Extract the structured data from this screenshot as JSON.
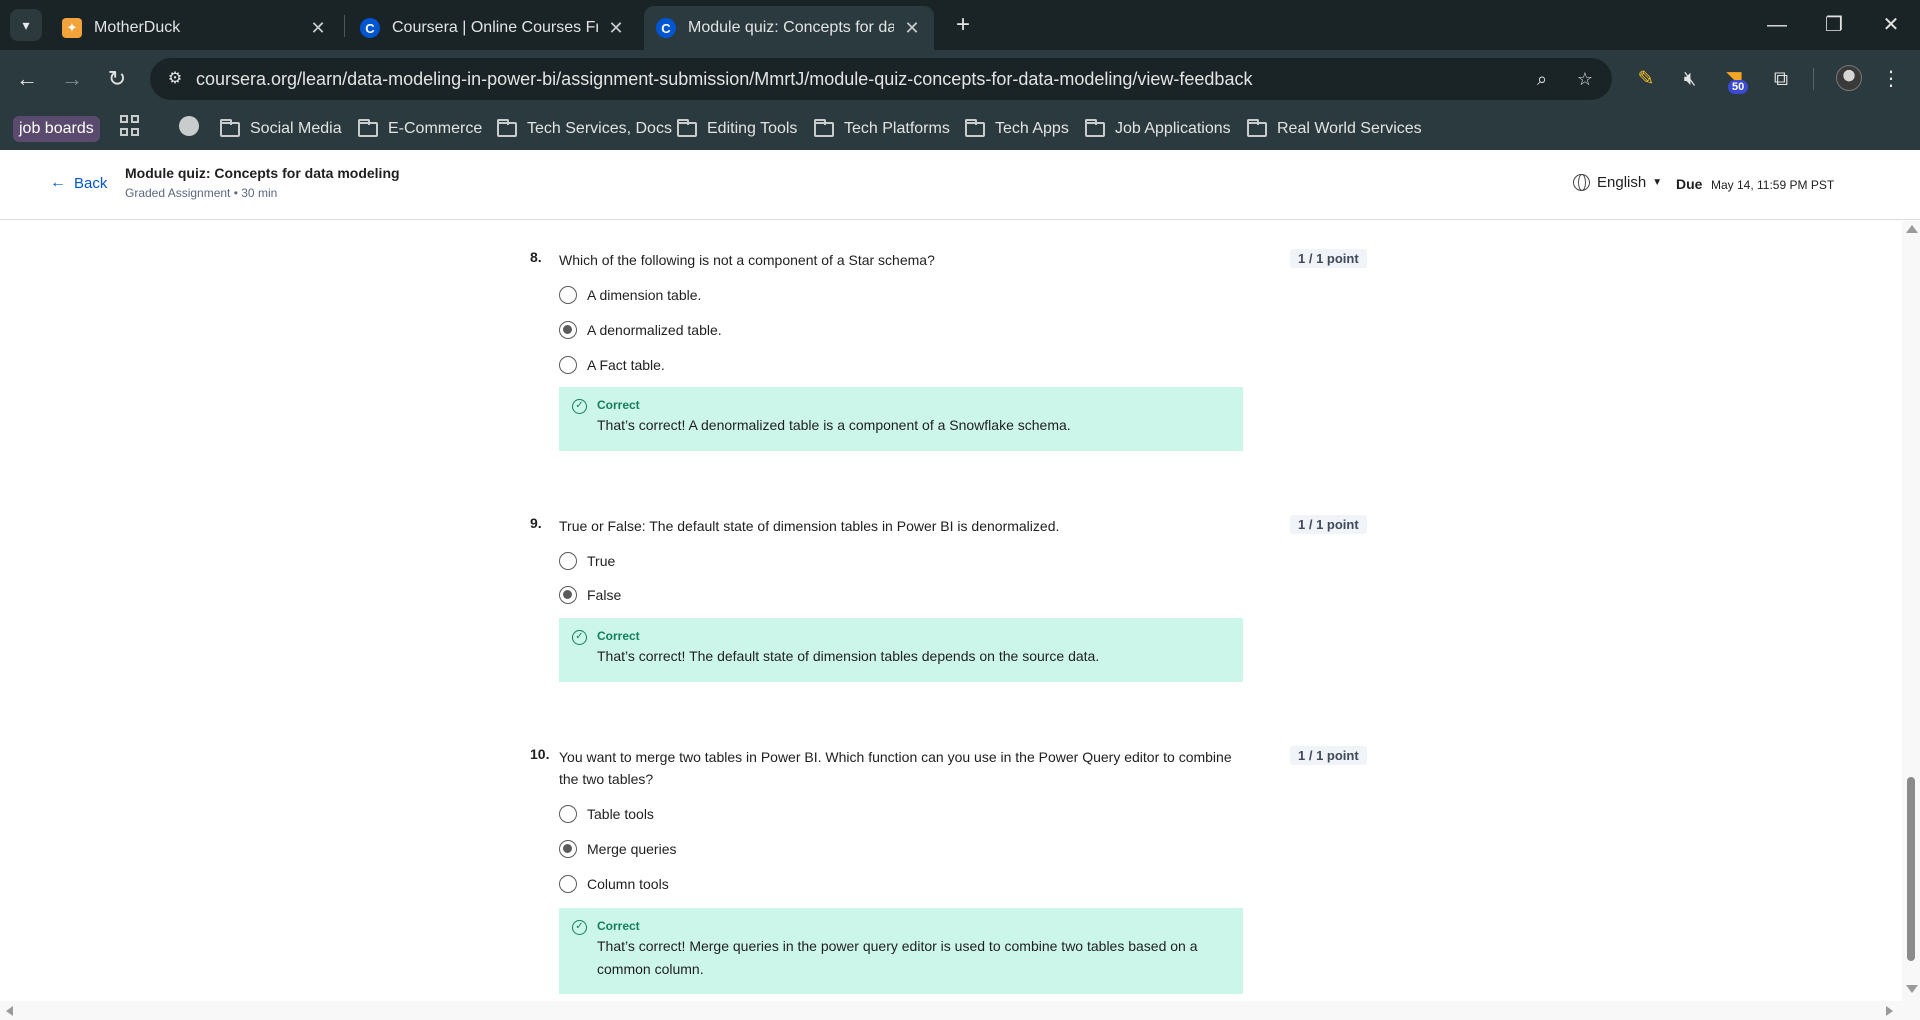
{
  "browser": {
    "tabs": [
      {
        "title": "MotherDuck",
        "favicon": "motherduck-icon",
        "active": false
      },
      {
        "title": "Coursera | Online Courses From",
        "favicon": "coursera-icon",
        "active": false
      },
      {
        "title": "Module quiz: Concepts for data",
        "favicon": "coursera-icon",
        "active": true
      }
    ],
    "url": "coursera.org/learn/data-modeling-in-power-bi/assignment-submission/MmrtJ/module-quiz-concepts-for-data-modeling/view-feedback",
    "extension_badge": "50",
    "bookmarks": [
      {
        "label": "job boards",
        "type": "tag"
      },
      {
        "label": "Social Media",
        "type": "folder"
      },
      {
        "label": "E-Commerce",
        "type": "folder"
      },
      {
        "label": "Tech Services, Docs",
        "type": "folder"
      },
      {
        "label": "Editing Tools",
        "type": "folder"
      },
      {
        "label": "Tech Platforms",
        "type": "folder"
      },
      {
        "label": "Tech Apps",
        "type": "folder"
      },
      {
        "label": "Job Applications",
        "type": "folder"
      },
      {
        "label": "Real World Services",
        "type": "folder"
      }
    ]
  },
  "header": {
    "back_label": "Back",
    "title": "Module quiz: Concepts for data modeling",
    "subtitle": "Graded Assignment • 30 min",
    "language": "English",
    "due_label": "Due",
    "due_date": "May 14, 11:59 PM PST"
  },
  "questions": [
    {
      "number": "8.",
      "text": "Which of the following is not a component of a Star schema?",
      "points": "1 / 1 point",
      "options": [
        {
          "label": "A dimension table.",
          "selected": false
        },
        {
          "label": "A denormalized table.",
          "selected": true
        },
        {
          "label": "A Fact table.",
          "selected": false
        }
      ],
      "feedback": {
        "label": "Correct",
        "text": "That’s correct! A denormalized table is a component of a Snowflake schema."
      }
    },
    {
      "number": "9.",
      "text": "True or False: The default state of dimension tables in Power BI is denormalized.",
      "points": "1 / 1 point",
      "options": [
        {
          "label": "True",
          "selected": false
        },
        {
          "label": "False",
          "selected": true
        }
      ],
      "feedback": {
        "label": "Correct",
        "text": "That’s correct! The default state of dimension tables depends on the source data."
      }
    },
    {
      "number": "10.",
      "text": "You want to merge two tables in Power BI. Which function can you use in the Power Query editor to combine the two tables?",
      "points": "1 / 1 point",
      "options": [
        {
          "label": "Table tools",
          "selected": false
        },
        {
          "label": "Merge queries",
          "selected": true
        },
        {
          "label": "Column tools",
          "selected": false
        }
      ],
      "feedback": {
        "label": "Correct",
        "text": "That’s correct! Merge queries in the power query editor is used to combine two tables based on a common column."
      }
    }
  ],
  "colors": {
    "feedback_bg": "#cdf6ea",
    "correct_green": "#137f5b",
    "link_blue": "#0056d2"
  }
}
